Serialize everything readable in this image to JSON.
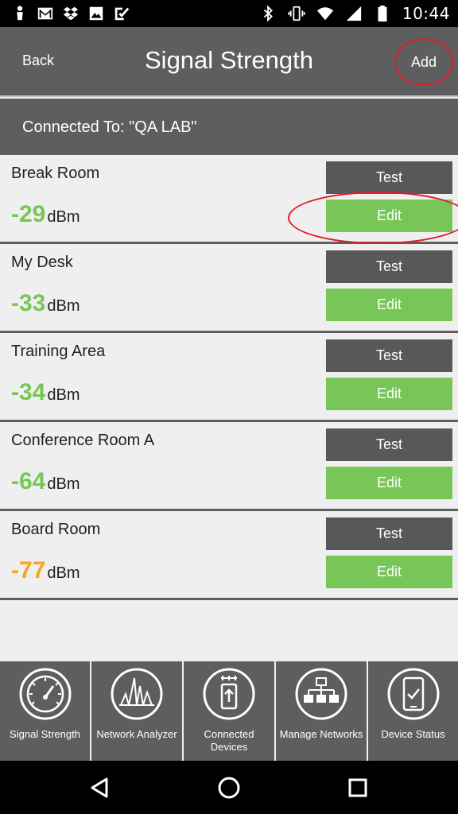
{
  "status_bar": {
    "time": "10:44",
    "left_icons": [
      "notification-icon",
      "gmail-icon",
      "dropbox-icon",
      "image-icon",
      "checkmark-app-icon"
    ],
    "right_icons": [
      "bluetooth-icon",
      "vibrate-icon",
      "wifi-icon",
      "cell-signal-icon",
      "battery-icon"
    ]
  },
  "header": {
    "back_label": "Back",
    "title": "Signal Strength",
    "add_label": "Add"
  },
  "connection": {
    "text": "Connected To: \"QA LAB\""
  },
  "locations": [
    {
      "name": "Break Room",
      "signal": "-29",
      "unit": "dBm",
      "test_label": "Test",
      "edit_label": "Edit"
    },
    {
      "name": "My Desk",
      "signal": "-33",
      "unit": "dBm",
      "test_label": "Test",
      "edit_label": "Edit"
    },
    {
      "name": "Training Area",
      "signal": "-34",
      "unit": "dBm",
      "test_label": "Test",
      "edit_label": "Edit"
    },
    {
      "name": "Conference Room A",
      "signal": "-64",
      "unit": "dBm",
      "test_label": "Test",
      "edit_label": "Edit"
    },
    {
      "name": "Board Room",
      "signal": "-77",
      "unit": "dBm",
      "test_label": "Test",
      "edit_label": "Edit"
    }
  ],
  "bottom_nav": [
    {
      "label": "Signal Strength",
      "icon": "gauge-icon"
    },
    {
      "label": "Network Analyzer",
      "icon": "spectrum-icon"
    },
    {
      "label": "Connected Devices",
      "icon": "connected-devices-icon"
    },
    {
      "label": "Manage Networks",
      "icon": "network-tree-icon"
    },
    {
      "label": "Device Status",
      "icon": "device-check-icon"
    }
  ],
  "colors": {
    "header_bg": "#5e5e60",
    "button_gray": "#58585a",
    "edit_green": "#79c658",
    "signal_good": "#79c658",
    "signal_weak": "#f5a623",
    "highlight_red": "#d8202a",
    "page_bg": "#efefef"
  }
}
